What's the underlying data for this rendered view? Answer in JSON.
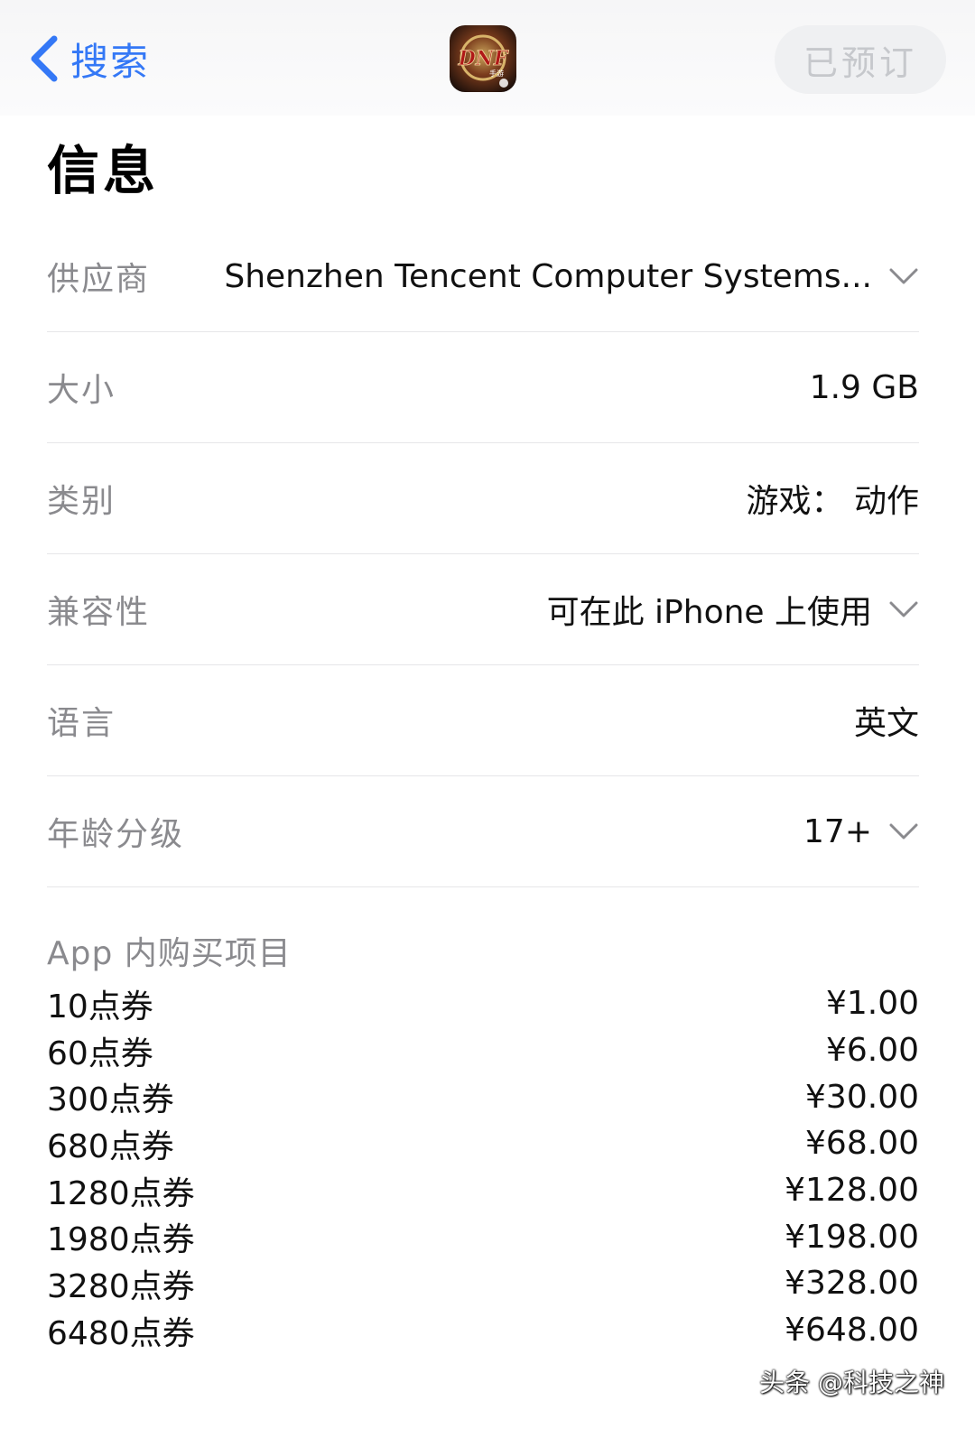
{
  "navbar": {
    "back_label": "搜索",
    "app_icon_text": "DNF",
    "app_icon_sub": "手游",
    "preorder_label": "已预订"
  },
  "page_title": "信息",
  "info": [
    {
      "label": "供应商",
      "value": "Shenzhen Tencent Computer Systems...",
      "expandable": true
    },
    {
      "label": "大小",
      "value": "1.9 GB",
      "expandable": false
    },
    {
      "label": "类别",
      "value": "游戏： 动作",
      "expandable": false
    },
    {
      "label": "兼容性",
      "value": "可在此 iPhone 上使用",
      "expandable": true
    },
    {
      "label": "语言",
      "value": "英文",
      "expandable": false
    },
    {
      "label": "年龄分级",
      "value": "17+",
      "expandable": true
    }
  ],
  "iap": {
    "title": "App 内购买项目",
    "items": [
      {
        "name": "10点券",
        "price": "¥1.00"
      },
      {
        "name": "60点券",
        "price": "¥6.00"
      },
      {
        "name": "300点券",
        "price": "¥30.00"
      },
      {
        "name": "680点券",
        "price": "¥68.00"
      },
      {
        "name": "1280点券",
        "price": "¥128.00"
      },
      {
        "name": "1980点券",
        "price": "¥198.00"
      },
      {
        "name": "3280点券",
        "price": "¥328.00"
      },
      {
        "name": "6480点券",
        "price": "¥648.00"
      }
    ]
  },
  "watermark": "头条 @科技之神",
  "colors": {
    "accent": "#3478f6",
    "label_gray": "#8a8a8e",
    "button_bg": "#eff0f2",
    "button_text": "#c6c8cc"
  }
}
